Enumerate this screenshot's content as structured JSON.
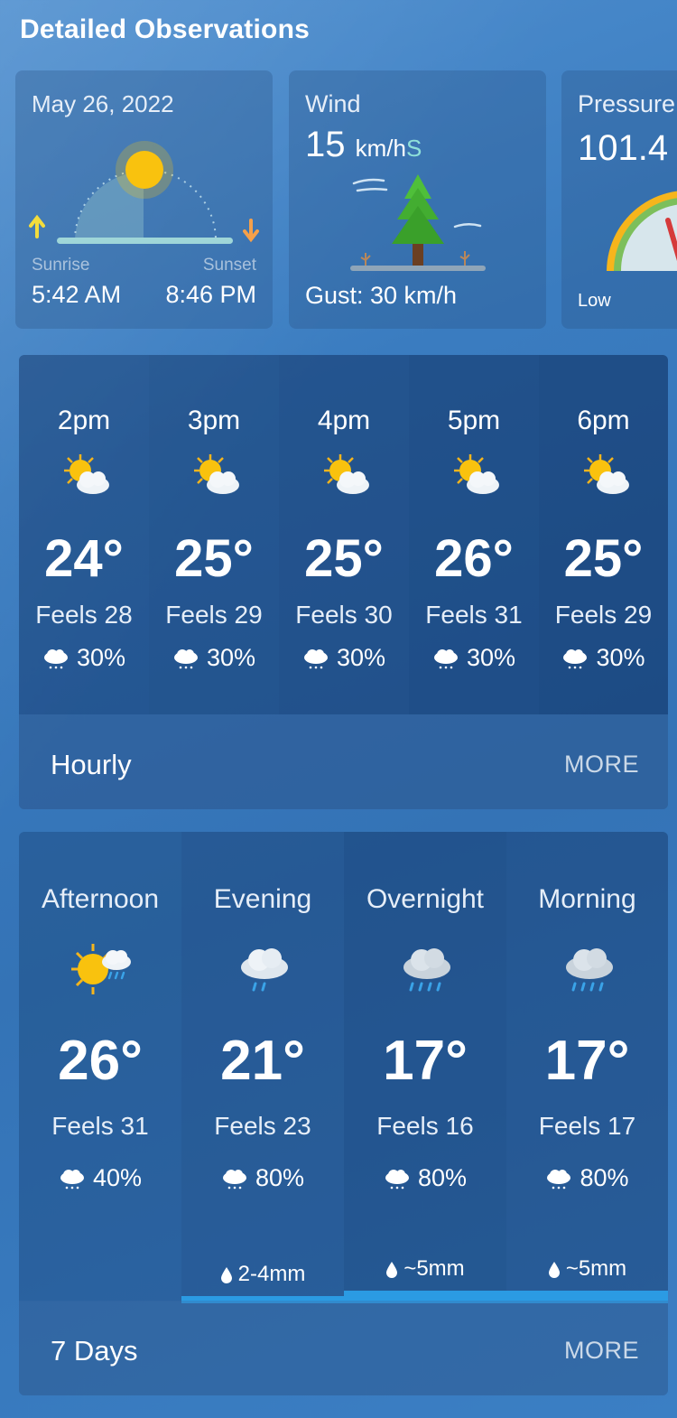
{
  "section_title": "Detailed Observations",
  "sun_card": {
    "date": "May 26, 2022",
    "sunrise_label": "Sunrise",
    "sunset_label": "Sunset",
    "sunrise_time": "5:42 AM",
    "sunset_time": "8:46 PM"
  },
  "wind_card": {
    "label": "Wind",
    "speed": "15",
    "unit": "km/h",
    "direction": "S",
    "gust": "Gust: 30 km/h"
  },
  "pressure_card": {
    "label": "Pressure",
    "value": "101.4",
    "low_label": "Low"
  },
  "hourly": {
    "items": [
      {
        "time": "2pm",
        "temp": "24°",
        "feels": "Feels 28",
        "precip": "30%",
        "icon": "partly-sunny-icon"
      },
      {
        "time": "3pm",
        "temp": "25°",
        "feels": "Feels 29",
        "precip": "30%",
        "icon": "partly-sunny-icon"
      },
      {
        "time": "4pm",
        "temp": "25°",
        "feels": "Feels 30",
        "precip": "30%",
        "icon": "partly-sunny-icon"
      },
      {
        "time": "5pm",
        "temp": "26°",
        "feels": "Feels 31",
        "precip": "30%",
        "icon": "partly-sunny-icon"
      },
      {
        "time": "6pm",
        "temp": "25°",
        "feels": "Feels 29",
        "precip": "30%",
        "icon": "partly-sunny-icon"
      }
    ],
    "footer_label": "Hourly",
    "more_label": "MORE"
  },
  "dayparts": {
    "items": [
      {
        "name": "Afternoon",
        "temp": "26°",
        "feels": "Feels 31",
        "precip": "40%",
        "amount": "",
        "icon": "sun-showers-icon"
      },
      {
        "name": "Evening",
        "temp": "21°",
        "feels": "Feels 23",
        "precip": "80%",
        "amount": "2-4mm",
        "icon": "rain-cloud-icon"
      },
      {
        "name": "Overnight",
        "temp": "17°",
        "feels": "Feels 16",
        "precip": "80%",
        "amount": "~5mm",
        "icon": "rain-cloud-icon"
      },
      {
        "name": "Morning",
        "temp": "17°",
        "feels": "Feels 17",
        "precip": "80%",
        "amount": "~5mm",
        "icon": "rain-cloud-icon"
      }
    ],
    "footer_label": "7 Days",
    "more_label": "MORE"
  },
  "colors": {
    "accent_bar": "#2b9be3",
    "wind_direction": "#8fe0d9",
    "sun": "#f9c20e"
  }
}
